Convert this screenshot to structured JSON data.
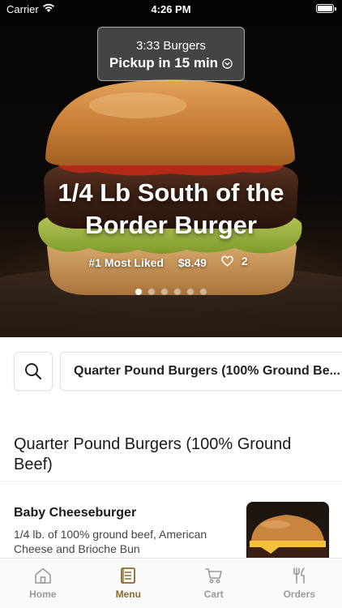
{
  "status_bar": {
    "carrier": "Carrier",
    "time": "4:26 PM"
  },
  "pickup": {
    "store": "3:33 Burgers",
    "time_label": "Pickup in 15 min"
  },
  "hero": {
    "title_line1": "1/4 Lb South of the",
    "title_line2": "Border Burger",
    "badge": "#1 Most Liked",
    "price": "$8.49",
    "likes": "2",
    "carousel_pages": 6,
    "carousel_active": 1
  },
  "search": {
    "icon": "search-icon",
    "category": "Quarter Pound Burgers (100% Ground Be..."
  },
  "section": {
    "title": "Quarter Pound Burgers (100% Ground Beef)"
  },
  "items": [
    {
      "name": "Baby Cheeseburger",
      "description": "1/4 lb. of 100% ground beef, American Cheese and Brioche Bun"
    }
  ],
  "tabbar": {
    "active_color": "#8a6a2a",
    "inactive_color": "#9a9a9a",
    "tabs": [
      {
        "label": "Home",
        "icon": "home-icon"
      },
      {
        "label": "Menu",
        "icon": "menu-icon"
      },
      {
        "label": "Cart",
        "icon": "cart-icon"
      },
      {
        "label": "Orders",
        "icon": "utensils-icon"
      }
    ]
  }
}
